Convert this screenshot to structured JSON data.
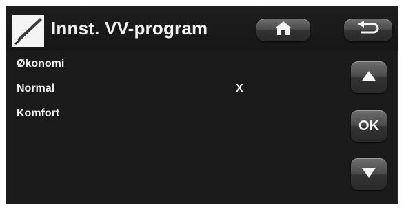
{
  "header": {
    "title": "Innst. VV-program"
  },
  "nav": {
    "ok_label": "OK"
  },
  "list": {
    "items": [
      {
        "label": "Økonomi",
        "selected_mark": ""
      },
      {
        "label": "Normal",
        "selected_mark": "X"
      },
      {
        "label": "Komfort",
        "selected_mark": ""
      }
    ]
  },
  "colors": {
    "screen_background": "#1b1b1b",
    "text": "#f4f4f4",
    "button_gradient_top": "#6f6f6f",
    "button_gradient_bottom": "#2a2a2a"
  },
  "icons": {
    "logo": "brush-icon",
    "home": "home-icon",
    "back": "back-arrow-icon",
    "up": "triangle-up-icon",
    "down": "triangle-down-icon"
  }
}
